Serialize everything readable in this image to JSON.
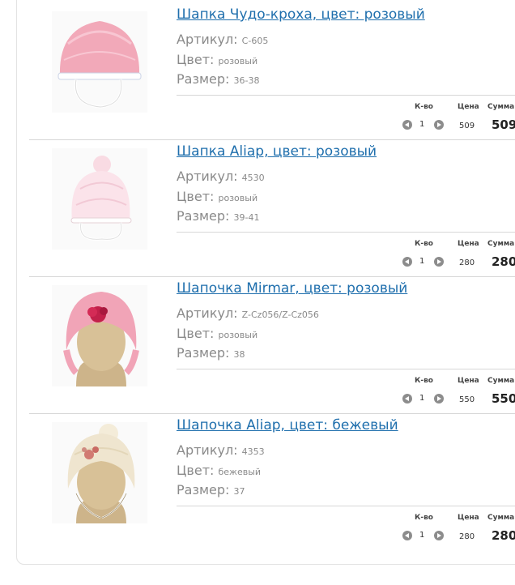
{
  "cart": {
    "headers": {
      "qty": "К-во",
      "price": "Цена",
      "sum": "Сумма"
    },
    "field_labels": {
      "article": "Артикул:",
      "color": "Цвет:",
      "size": "Размер:"
    },
    "items": [
      {
        "title": "Шапка Чудо-кроха, цвет: розовый",
        "article": "С-605",
        "color": "розовый",
        "size": "36-38",
        "qty": "1",
        "price": "509",
        "sum": "509",
        "image": "pink-knit-hat"
      },
      {
        "title": "Шапка Aliap, цвет: розовый",
        "article": "4530",
        "color": "розовый",
        "size": "39-41",
        "qty": "1",
        "price": "280",
        "sum": "280",
        "image": "light-pink-pompom-hat"
      },
      {
        "title": "Шапочка Mirmar, цвет: розовый",
        "article": "Z-Cz056/Z-Cz056",
        "color": "розовый",
        "size": "38",
        "qty": "1",
        "price": "550",
        "sum": "550",
        "image": "pink-helmet-hat-with-flower"
      },
      {
        "title": "Шапочка Aliap, цвет: бежевый",
        "article": "4353",
        "color": "бежевый",
        "size": "37",
        "qty": "1",
        "price": "280",
        "sum": "280",
        "image": "beige-pompom-hat"
      }
    ]
  }
}
